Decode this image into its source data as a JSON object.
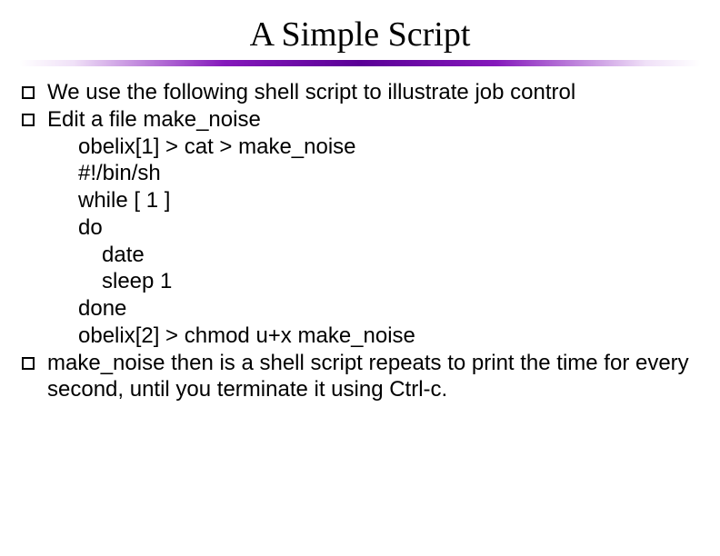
{
  "title": "A Simple Script",
  "bullets": {
    "b1": "We use the following shell script to illustrate job control",
    "b2": "Edit a file make_noise",
    "b3": "make_noise then is a shell script repeats to print the time for every second, until you terminate it using Ctrl-c."
  },
  "code": {
    "l1": "obelix[1] > cat > make_noise",
    "l2": "#!/bin/sh",
    "l3": "while [ 1 ]",
    "l4": "do",
    "l5": "date",
    "l6": "sleep 1",
    "l7": "done",
    "l8": "obelix[2] > chmod u+x make_noise"
  }
}
